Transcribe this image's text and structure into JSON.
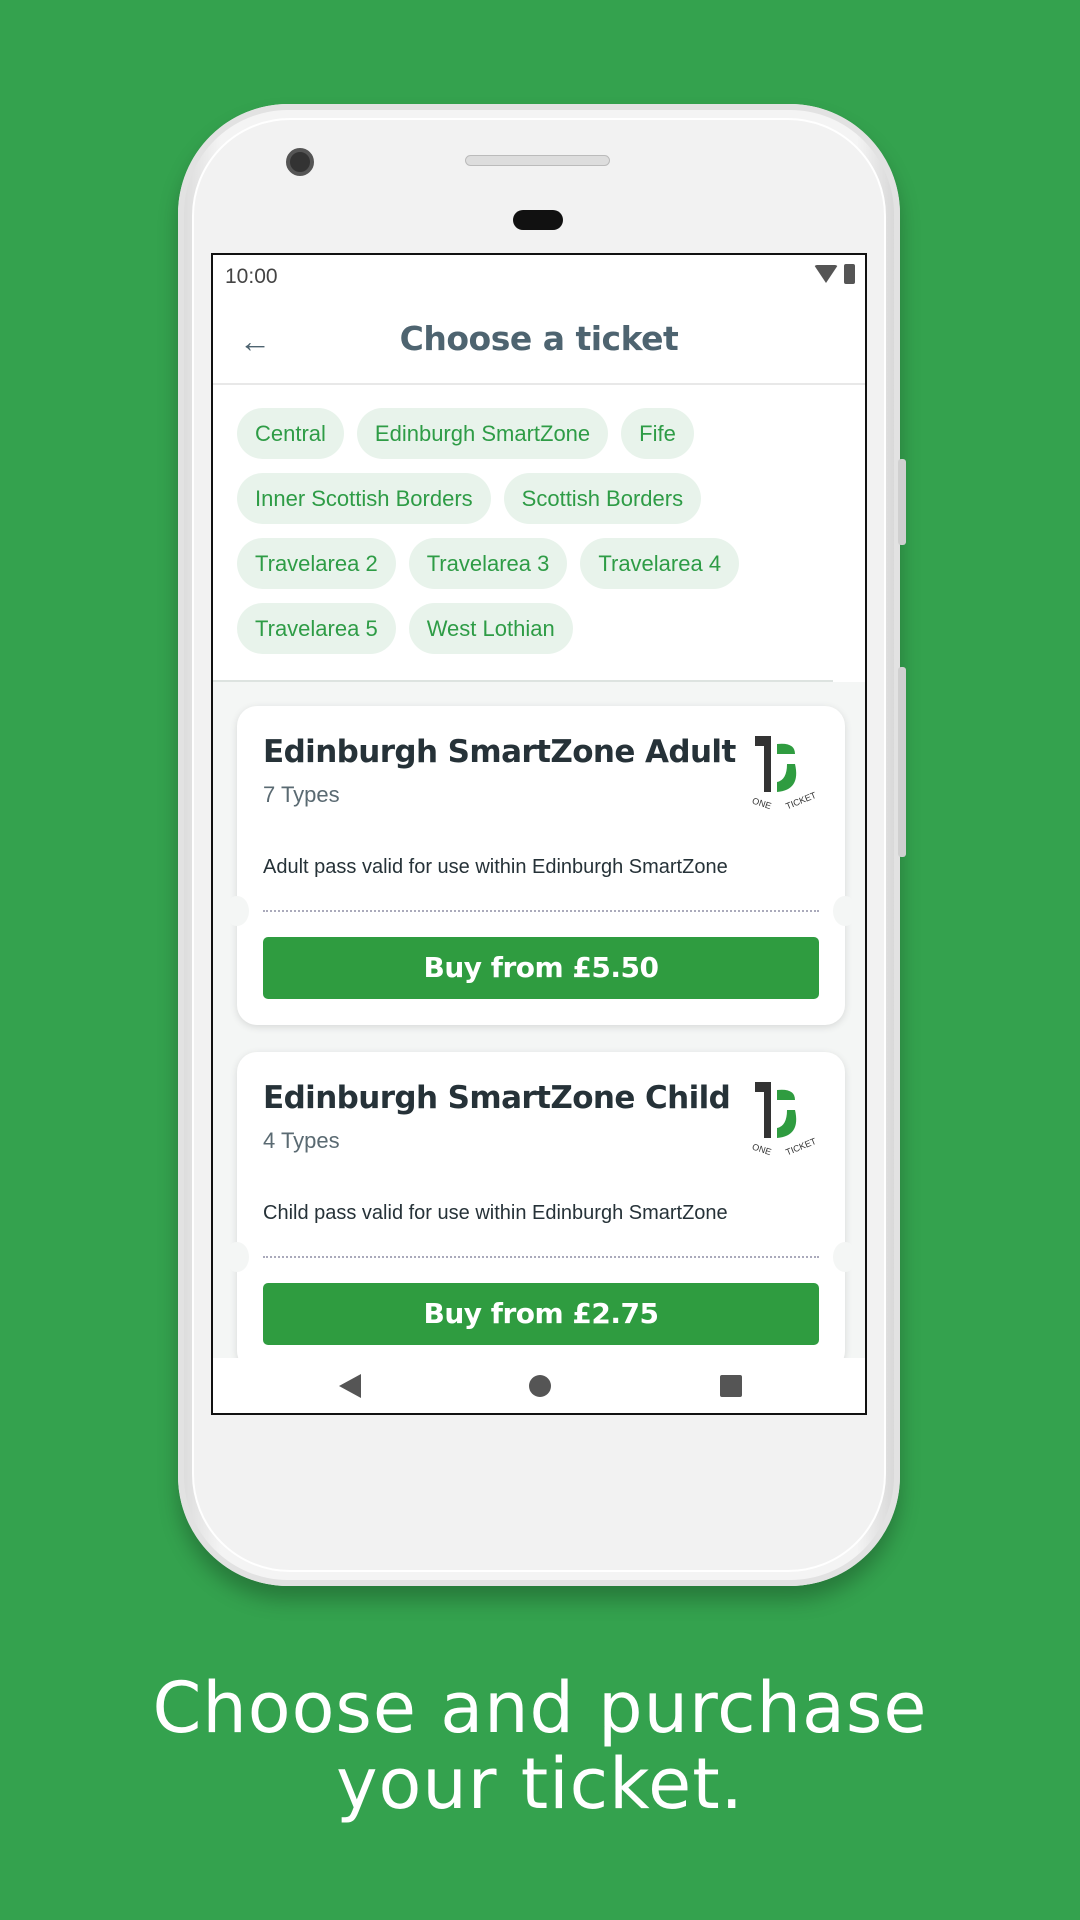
{
  "status": {
    "time": "10:00"
  },
  "header": {
    "title": "Choose a ticket",
    "back_icon": "arrow-left-icon"
  },
  "chips": [
    "Central",
    "Edinburgh SmartZone",
    "Fife",
    "Inner Scottish Borders",
    "Scottish Borders",
    "Travelarea 2",
    "Travelarea 3",
    "Travelarea 4",
    "Travelarea 5",
    "West Lothian"
  ],
  "tickets": [
    {
      "title": "Edinburgh SmartZone Adult",
      "types": "7 Types",
      "description": "Adult pass valid for use within Edinburgh SmartZone",
      "button": "Buy from £5.50",
      "logo": "ONE TICKET"
    },
    {
      "title": "Edinburgh SmartZone Child",
      "types": "4 Types",
      "description": "Child pass valid for use within Edinburgh SmartZone",
      "button": "Buy from £2.75",
      "logo": "ONE TICKET"
    }
  ],
  "caption": {
    "line1": "Choose and purchase",
    "line2": "your ticket."
  },
  "colors": {
    "background": "#34a24e",
    "accent": "#2f9c40",
    "chip_bg": "#e8f3eb",
    "title": "#4e6470"
  }
}
